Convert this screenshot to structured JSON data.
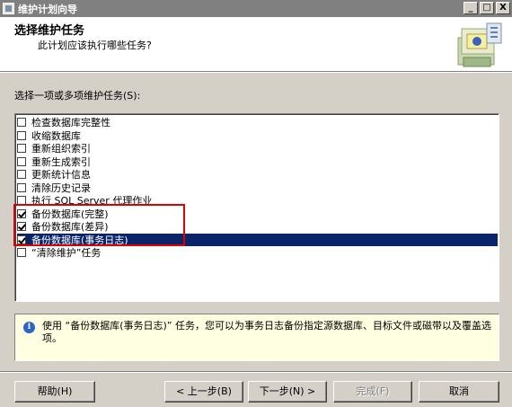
{
  "window": {
    "title": "维护计划向导",
    "controls": {
      "minimize": "_",
      "maximize": "□",
      "close": "X"
    }
  },
  "header": {
    "title": "选择维护任务",
    "subtitle": "此计划应该执行哪些任务?"
  },
  "task_list": {
    "label": "选择一项或多项维护任务(S):",
    "items": [
      {
        "label": "检查数据库完整性",
        "checked": false,
        "selected": false
      },
      {
        "label": "收缩数据库",
        "checked": false,
        "selected": false
      },
      {
        "label": "重新组织索引",
        "checked": false,
        "selected": false
      },
      {
        "label": "重新生成索引",
        "checked": false,
        "selected": false
      },
      {
        "label": "更新统计信息",
        "checked": false,
        "selected": false
      },
      {
        "label": "清除历史记录",
        "checked": false,
        "selected": false
      },
      {
        "label": "执行 SQL Server 代理作业",
        "checked": false,
        "selected": false
      },
      {
        "label": "备份数据库(完整)",
        "checked": true,
        "selected": false
      },
      {
        "label": "备份数据库(差异)",
        "checked": true,
        "selected": false
      },
      {
        "label": "备份数据库(事务日志)",
        "checked": true,
        "selected": true
      },
      {
        "label": "“清除维护”任务",
        "checked": false,
        "selected": false
      }
    ]
  },
  "info": {
    "text": "使用 “备份数据库(事务日志)” 任务，您可以为事务日志备份指定源数据库、目标文件或磁带以及覆盖选项。"
  },
  "buttons": {
    "help": "帮助(H)",
    "back": "< 上一步(B)",
    "next": "下一步(N) >",
    "finish": "完成(F)",
    "cancel": "取消"
  },
  "colors": {
    "selection": "#0a246a",
    "annotation_box": "#e00000",
    "info_background": "#ffffe1"
  }
}
